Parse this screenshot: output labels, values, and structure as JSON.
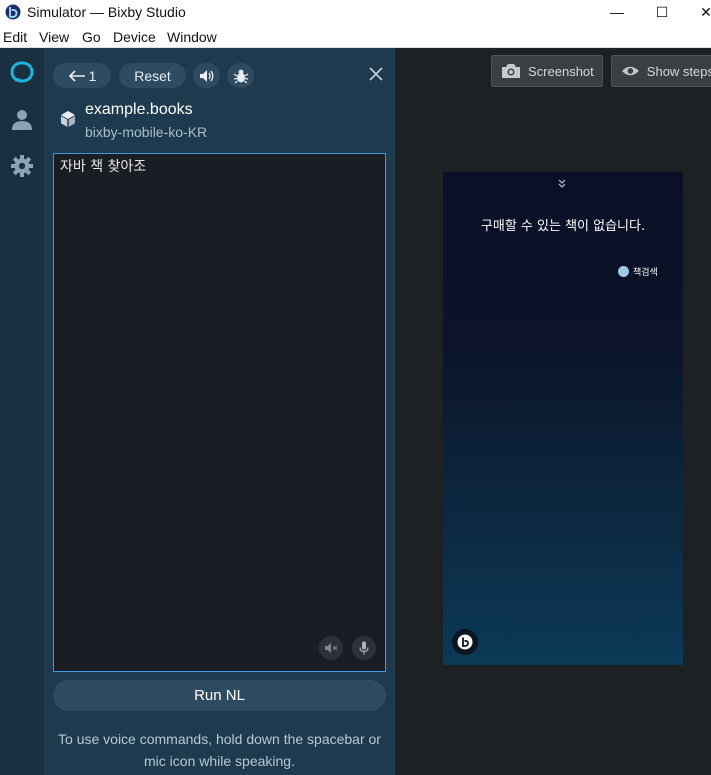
{
  "window": {
    "title": "Simulator — Bixby Studio",
    "controls": {
      "minimize": "—",
      "maximize": "☐",
      "close": "✕"
    }
  },
  "menu": [
    "Edit",
    "View",
    "Go",
    "Device",
    "Window"
  ],
  "rail": {
    "icons": [
      "bixby-logo-icon",
      "user-icon",
      "settings-gear-icon"
    ],
    "accent": "#1cb5e0"
  },
  "toolbar": {
    "back_label": "1",
    "reset_label": "Reset",
    "icons": [
      "back-arrow-icon",
      "speaker-icon",
      "bug-icon",
      "close-icon"
    ]
  },
  "capsule": {
    "name": "example.books",
    "target": "bixby-mobile-ko-KR"
  },
  "nl_input": {
    "value": "자바 책 찾아조"
  },
  "run_button": "Run NL",
  "hint_lines": [
    "To use voice commands, hold down the spacebar or",
    "mic icon while speaking."
  ],
  "preview": {
    "screenshot_label": "Screenshot",
    "show_steps_label": "Show steps",
    "device_message": "구매할 수 있는 책이 없습니다.",
    "chip_label": "책검색"
  },
  "colors": {
    "panel": "#1e3a4f",
    "rail": "#18303f",
    "input_border": "#3a9ad9",
    "button": "#2f4b61"
  }
}
